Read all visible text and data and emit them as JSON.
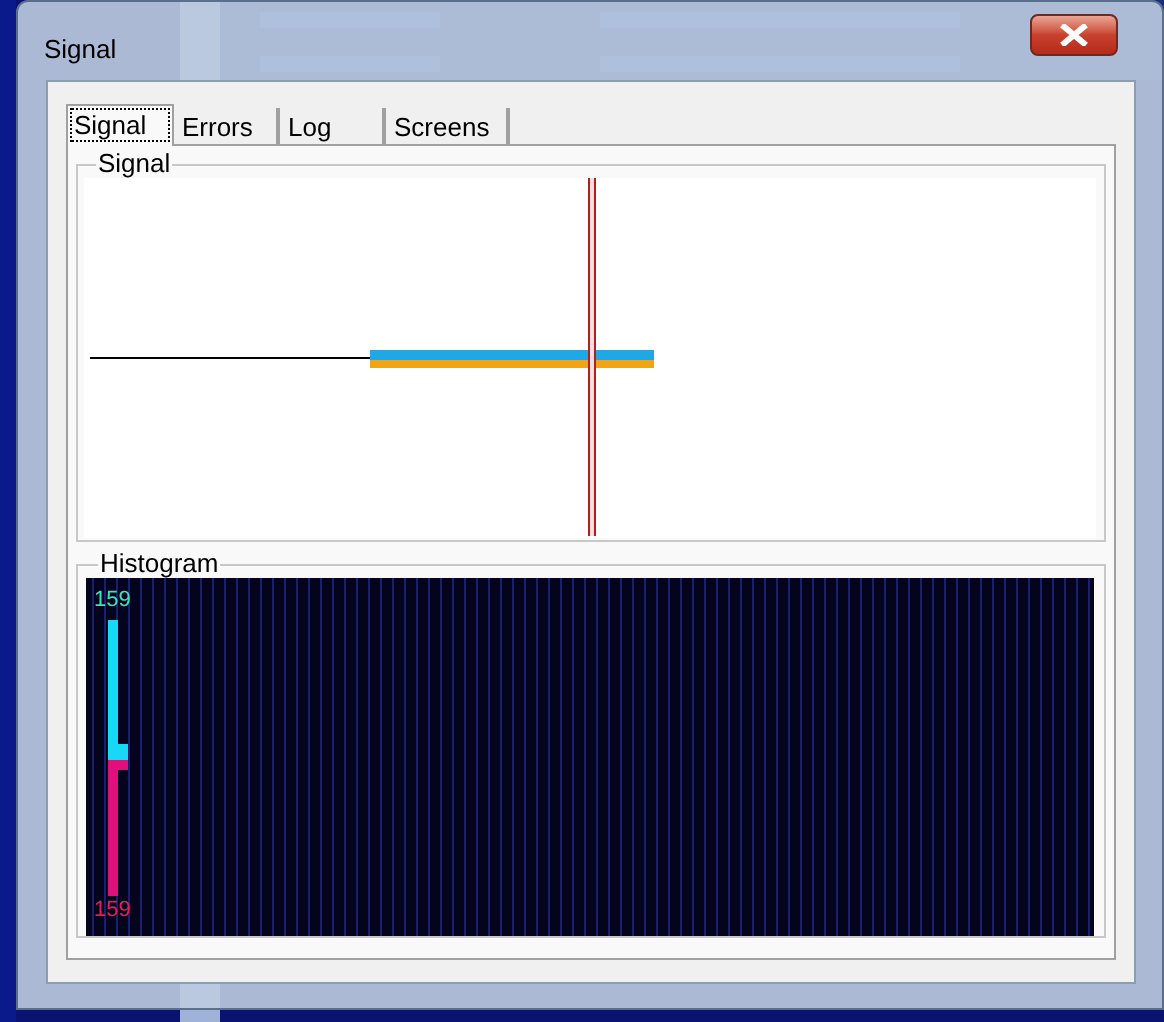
{
  "window": {
    "title": "Signal"
  },
  "tabs": [
    {
      "label": "Signal",
      "selected": true
    },
    {
      "label": "Errors",
      "selected": false
    },
    {
      "label": "Log",
      "selected": false
    },
    {
      "label": "Screens",
      "selected": false
    }
  ],
  "signal_group": {
    "title": "Signal"
  },
  "histogram_group": {
    "title": "Histogram",
    "top_label": "159",
    "bottom_label": "159"
  }
}
